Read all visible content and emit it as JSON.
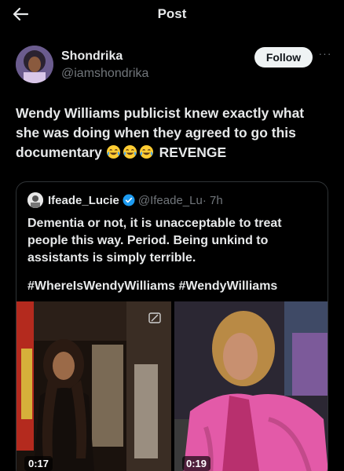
{
  "topbar": {
    "title": "Post",
    "back_icon": "arrow-left-icon"
  },
  "author": {
    "display_name": "Shondrika",
    "handle": "@iamshondrika",
    "follow_label": "Follow",
    "more_label": "···"
  },
  "tweet": {
    "text": "Wendy Williams publicist knew exactly what she was doing when they agreed to go this documentary",
    "emoji": "face-with-tears-of-joy-icon",
    "tail": "REVENGE"
  },
  "quote": {
    "name": "Ifeade_Lucie",
    "handle": "@Ifeade_Lu",
    "time": "· 7h",
    "text": "Dementia or not, it is unacceptable to treat people this way. Period. Being unkind to assistants is simply terrible.",
    "hashtags": "#WhereIsWendyWilliams #WendyWilliams",
    "media": [
      {
        "duration": "0:17"
      },
      {
        "duration": "0:19"
      }
    ]
  },
  "colors": {
    "background": "#000000",
    "text": "#e7e9ea",
    "muted": "#71767b",
    "verified": "#1d9bf0",
    "border": "#2f3336"
  }
}
